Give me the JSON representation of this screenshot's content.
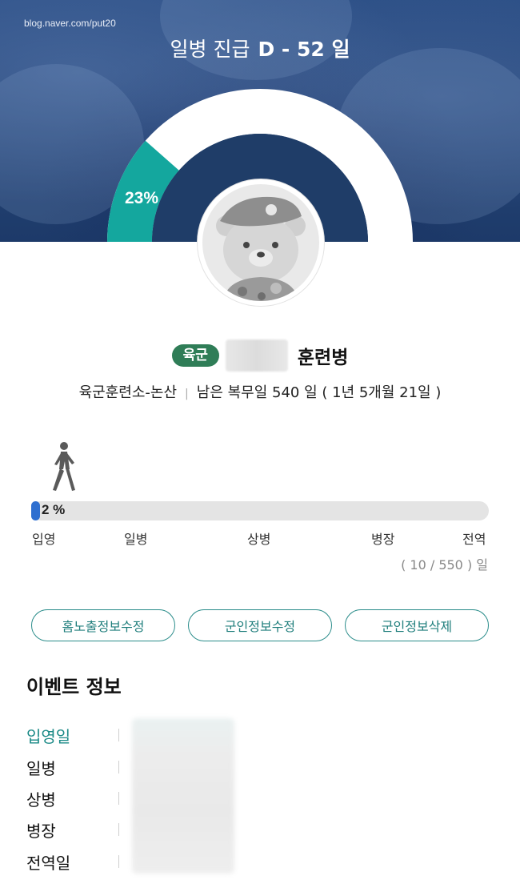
{
  "header": {
    "source": "blog.naver.com/put20",
    "title": "일병 진급",
    "dday": "D - 52 일"
  },
  "gauge": {
    "percent_label": "23%",
    "percent": 0.23,
    "colors": {
      "fill": "#14a79e",
      "track": "#ffffff",
      "inner": "#1f3d68"
    }
  },
  "profile": {
    "branch": "육군",
    "rank": "훈련병",
    "unit": "육군훈련소-논산",
    "remaining": "남은 복무일 540 일 ( 1년 5개월 21일 )"
  },
  "progress": {
    "percent_label": "2 %",
    "fraction": 0.02,
    "milestones": [
      "입영",
      "일병",
      "상병",
      "병장",
      "전역"
    ],
    "days": "( 10 / 550 ) 일"
  },
  "actions": {
    "btn1": "홈노출정보수정",
    "btn2": "군인정보수정",
    "btn3": "군인정보삭제"
  },
  "events": {
    "title": "이벤트 정보",
    "rows": [
      "입영일",
      "일병",
      "상병",
      "병장",
      "전역일"
    ]
  },
  "icons": {
    "avatar": "soldier-bear-avatar-icon",
    "walker": "walking-person-icon"
  }
}
